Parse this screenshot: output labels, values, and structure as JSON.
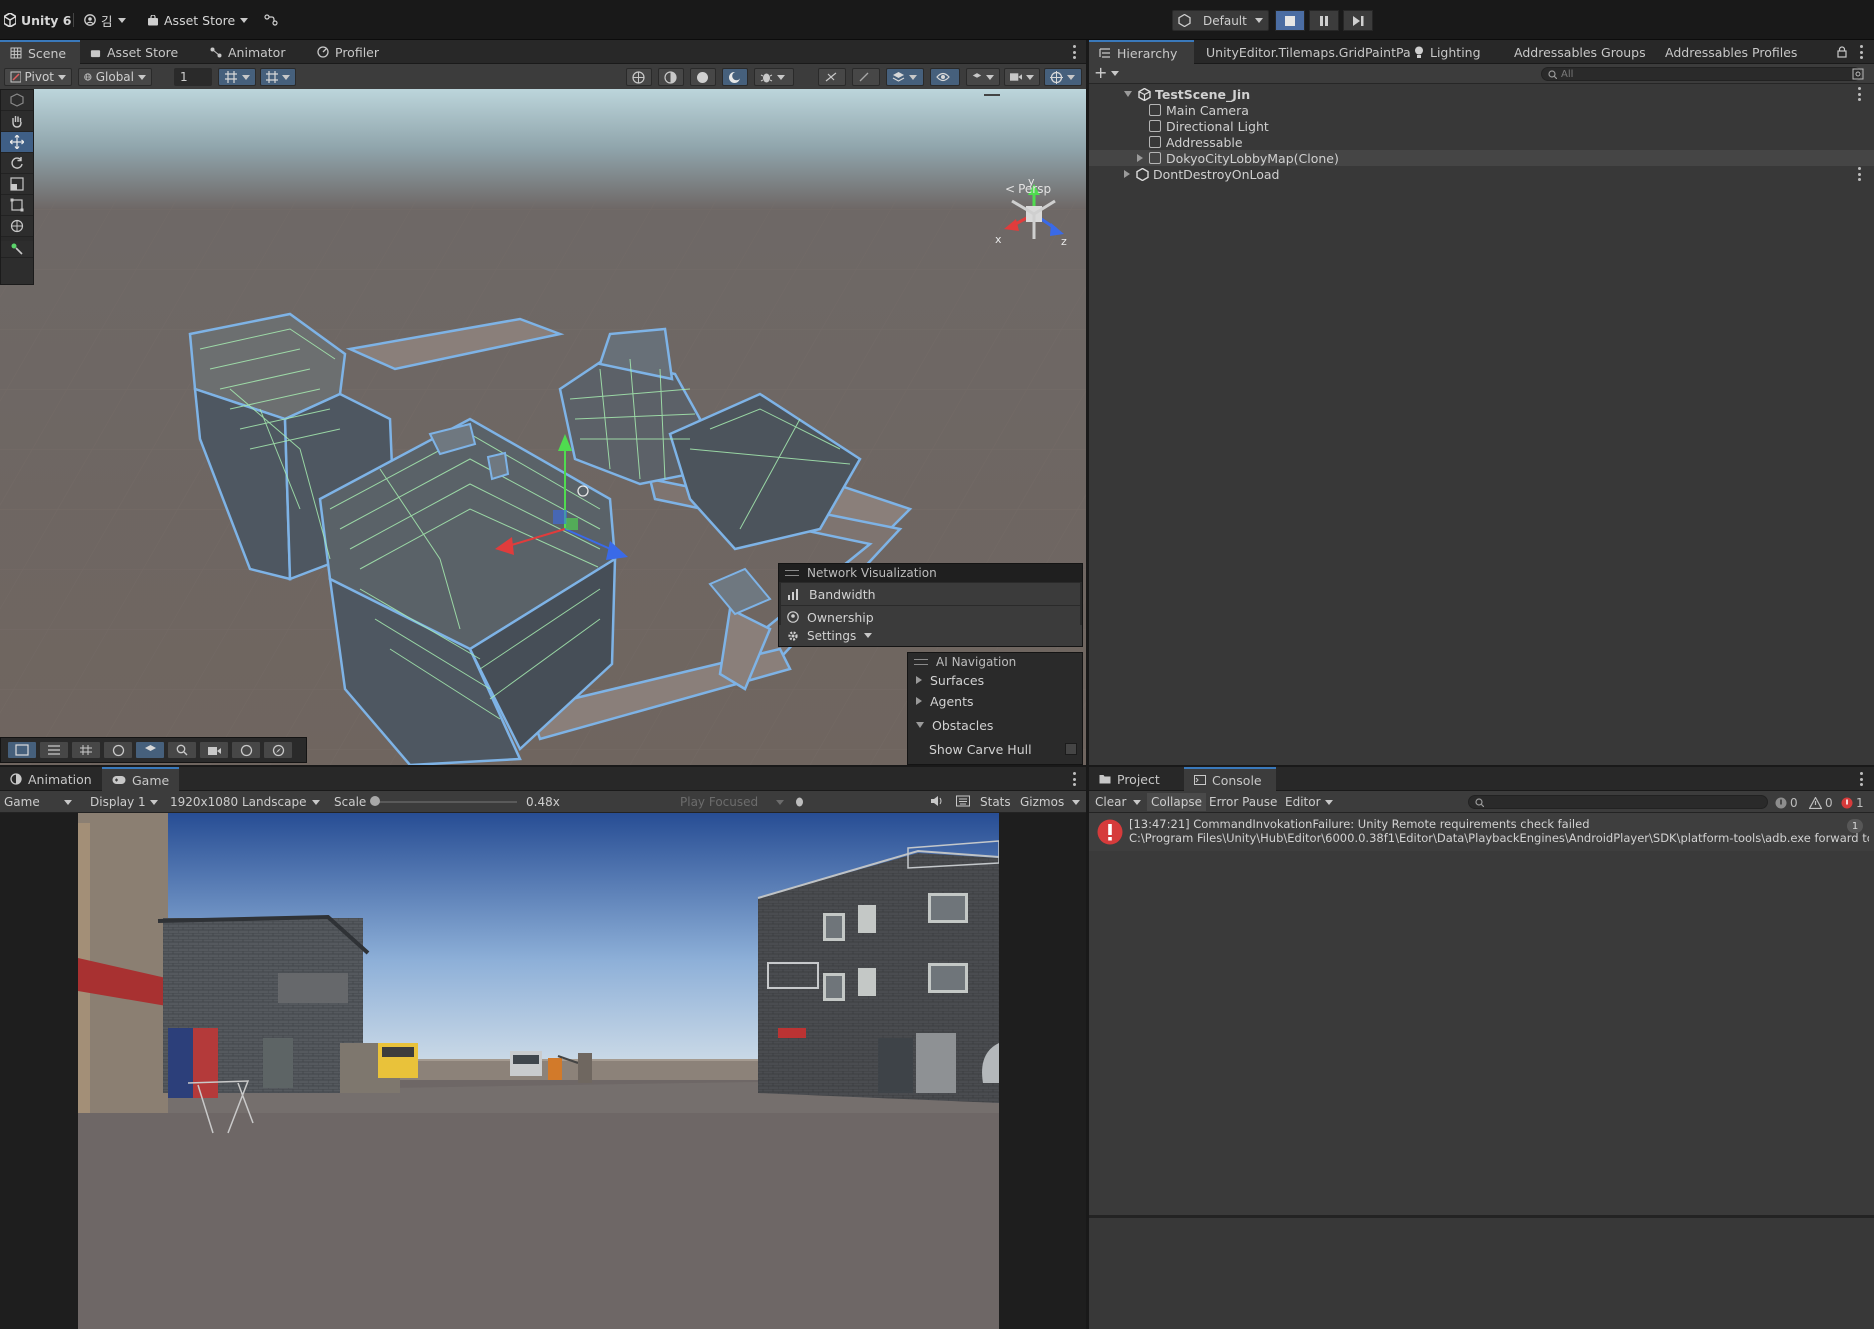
{
  "topbar": {
    "app_title": "Unity 6",
    "account_label": "김",
    "asset_store_label": "Asset Store",
    "layout_label": "Default"
  },
  "scene_panel": {
    "tabs": [
      {
        "label": "Scene",
        "active": true
      },
      {
        "label": "Asset Store",
        "active": false
      },
      {
        "label": "Animator",
        "active": false
      },
      {
        "label": "Profiler",
        "active": false
      }
    ],
    "pivot_label": "Pivot",
    "global_label": "Global",
    "grid_snap_value": "1",
    "persp_label": "Persp",
    "gizmo_axes": {
      "x": "x",
      "y": "y",
      "z": "z"
    },
    "network_visualization": {
      "title": "Network Visualization",
      "items": [
        "Bandwidth",
        "Ownership",
        "Settings"
      ]
    },
    "ai_navigation": {
      "title": "AI Navigation",
      "items": [
        "Surfaces",
        "Agents",
        "Obstacles"
      ],
      "show_carve_hull": "Show Carve Hull"
    }
  },
  "hierarchy_panel": {
    "tabs": [
      {
        "label": "Hierarchy",
        "active": true
      },
      {
        "label": "UnityEditor.Tilemaps.GridPaintPa",
        "active": false
      },
      {
        "label": "Lighting",
        "active": false
      },
      {
        "label": "Addressables Groups",
        "active": false
      },
      {
        "label": "Addressables Profiles",
        "active": false
      }
    ],
    "search_placeholder": "All",
    "items": [
      {
        "label": "TestScene_Jin",
        "bold": true
      },
      {
        "label": "Main Camera"
      },
      {
        "label": "Directional Light"
      },
      {
        "label": "Addressable"
      },
      {
        "label": "DokyoCityLobbyMap(Clone)"
      },
      {
        "label": "DontDestroyOnLoad"
      }
    ]
  },
  "game_panel": {
    "tabs": [
      {
        "label": "Animation",
        "active": false
      },
      {
        "label": "Game",
        "active": true
      }
    ],
    "mode_label": "Game",
    "display_label": "Display 1",
    "resolution_label": "1920x1080 Landscape",
    "scale_label": "Scale",
    "scale_value": "0.48x",
    "scale_fraction": 0.0,
    "play_focused_label": "Play Focused",
    "stats_label": "Stats",
    "gizmos_label": "Gizmos"
  },
  "console_panel": {
    "tabs": [
      {
        "label": "Project",
        "active": false
      },
      {
        "label": "Console",
        "active": true
      }
    ],
    "clear_label": "Clear",
    "collapse_label": "Collapse",
    "error_pause_label": "Error Pause",
    "editor_label": "Editor",
    "log_count": "0",
    "warning_count": "0",
    "error_count": "1",
    "entries": [
      {
        "line1": "[13:47:21] CommandInvokationFailure: Unity Remote requirements check failed",
        "line2": "C:\\Program Files\\Unity\\Hub\\Editor\\6000.0.38f1\\Editor\\Data\\PlaybackEngines\\AndroidPlayer\\SDK\\platform-tools\\adb.exe forward tc",
        "count": "1"
      }
    ]
  },
  "colors": {
    "accent": "#3a79bb",
    "error": "#d63b3b",
    "wireframe": "#9fe5a8",
    "selection_outline": "#6fa9e0"
  }
}
